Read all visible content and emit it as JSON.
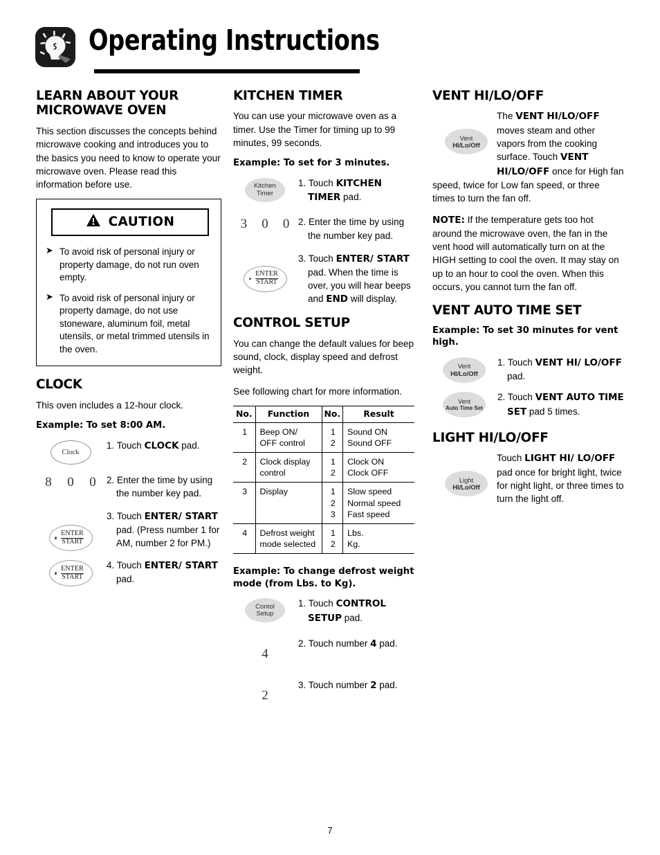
{
  "page": {
    "title": "Operating Instructions",
    "number": "7",
    "header_icon": "lightbulb-icon"
  },
  "left_column": {
    "learn": {
      "heading": "LEARN ABOUT YOUR MICROWAVE OVEN",
      "paragraph": "This section discusses the concepts behind microwave cooking and introduces you to the basics you need to know to operate your microwave oven. Please read this information before use."
    },
    "caution": {
      "label": "CAUTION",
      "icon": "warning-triangle-icon",
      "bullets": [
        "To avoid risk of personal injury or property damage, do not run oven empty.",
        "To avoid risk of personal injury or property damage, do not use stoneware, aluminum foil, metal utensils, or metal trimmed utensils in the oven."
      ]
    },
    "clock": {
      "heading": "CLOCK",
      "paragraph": "This oven includes a 12-hour clock.",
      "example": "Example: To set 8:00 AM.",
      "steps": [
        {
          "pad": "Clock",
          "num": "1.",
          "text_prefix": "Touch ",
          "text_bold": "CLOCK",
          "text_suffix": " pad."
        },
        {
          "digits": [
            "8",
            "0",
            "0"
          ],
          "num": "2.",
          "text_prefix": "Enter the time by using the number key pad.",
          "text_bold": "",
          "text_suffix": ""
        },
        {
          "pad": "ENTER/START",
          "num": "3.",
          "text_prefix": "Touch ",
          "text_bold": "ENTER/ START",
          "text_suffix": " pad. (Press number 1 for AM, number 2 for PM.)"
        },
        {
          "pad": "ENTER/START",
          "num": "4.",
          "text_prefix": "Touch ",
          "text_bold": "ENTER/ START",
          "text_suffix": " pad."
        }
      ]
    }
  },
  "mid_column": {
    "kitchen_timer": {
      "heading": "KITCHEN TIMER",
      "paragraph": "You can use your microwave oven as a timer. Use the Timer for timing up to 99 minutes, 99 seconds.",
      "example": "Example: To set for 3 minutes.",
      "pad_kitchen_l1": "Kitchen",
      "pad_kitchen_l2": "Timer",
      "digits": [
        "3",
        "0",
        "0"
      ],
      "step1_num": "1.",
      "step1_prefix": "Touch ",
      "step1_bold": "KITCHEN TIMER",
      "step1_suffix": " pad.",
      "step2_num": "2.",
      "step2_text": "Enter the time by using the number key pad.",
      "step3_num": "3.",
      "step3_prefix": "Touch ",
      "step3_bold": "ENTER/ START",
      "step3_mid": " pad. When the time is over, you will hear beeps and ",
      "step3_bold2": "END",
      "step3_suffix": " will display."
    },
    "control_setup": {
      "heading": "CONTROL SETUP",
      "paragraph1": "You can change the default values for beep sound, clock, display speed and defrost weight.",
      "paragraph2": "See following chart for more information.",
      "table": {
        "headers": [
          "No.",
          "Function",
          "No.",
          "Result"
        ],
        "rows": [
          {
            "no": "1",
            "function": "Beep ON/\nOFF control",
            "no2": "1\n2",
            "result": "Sound ON\nSound OFF"
          },
          {
            "no": "2",
            "function": "Clock display\ncontrol",
            "no2": "1\n2",
            "result": "Clock ON\nClock OFF"
          },
          {
            "no": "3",
            "function": "Display",
            "no2": "1\n2\n3",
            "result": "Slow speed\nNormal speed\nFast speed"
          },
          {
            "no": "4",
            "function": "Defrost weight\nmode selected",
            "no2": "1\n2",
            "result": "Lbs.\nKg."
          }
        ]
      },
      "example": "Example: To change defrost weight mode (from Lbs. to Kg).",
      "pad_control_l1": "Contol",
      "pad_control_l2": "Setup",
      "step1_num": "1.",
      "step1_prefix": "Touch ",
      "step1_bold": "CONTROL SETUP",
      "step1_suffix": " pad.",
      "step2_num": "2.",
      "step2_digit": "4",
      "step2_prefix": "Touch number ",
      "step2_bold": "4",
      "step2_suffix": " pad.",
      "step3_num": "3.",
      "step3_digit": "2",
      "step3_prefix": "Touch number ",
      "step3_bold": "2",
      "step3_suffix": " pad."
    }
  },
  "right_column": {
    "vent": {
      "heading": "VENT HI/LO/OFF",
      "pad_l1": "Vent",
      "pad_l2": "HI/Lo/Off",
      "text_prefix": "The ",
      "text_bold1": "VENT HI/LO/OFF",
      "text_mid": " moves steam and other vapors from the cooking surface. Touch ",
      "text_bold2": "VENT HI/LO/OFF",
      "text_suffix": " once for High fan speed, twice for Low fan speed, or three times to turn the fan off.",
      "note_label": "NOTE:",
      "note_text": " If the temperature gets too hot around the microwave oven, the fan in the vent hood will automatically turn on at the HIGH setting to cool the oven. It may stay on up to an hour to cool the oven. When this occurs, you cannot turn the fan off."
    },
    "vent_auto": {
      "heading": "VENT AUTO TIME SET",
      "example": "Example: To set 30 minutes for vent high.",
      "pad1_l1": "Vent",
      "pad1_l2": "HI/Lo/Off",
      "pad2_l1": "Vent",
      "pad2_l2": "Auto Time Set",
      "step1_num": "1.",
      "step1_prefix": "Touch ",
      "step1_bold": "VENT HI/ LO/OFF",
      "step1_suffix": " pad.",
      "step2_num": "2.",
      "step2_prefix": "Touch ",
      "step2_bold": "VENT AUTO TIME SET",
      "step2_suffix": " pad 5 times."
    },
    "light": {
      "heading": "LIGHT HI/LO/OFF",
      "pad_l1": "Light",
      "pad_l2": "HI/Lo/Off",
      "text_prefix": "Touch ",
      "text_bold": "LIGHT HI/ LO/OFF",
      "text_suffix": " pad once for bright light, twice for night light, or three times to turn the light off."
    }
  }
}
